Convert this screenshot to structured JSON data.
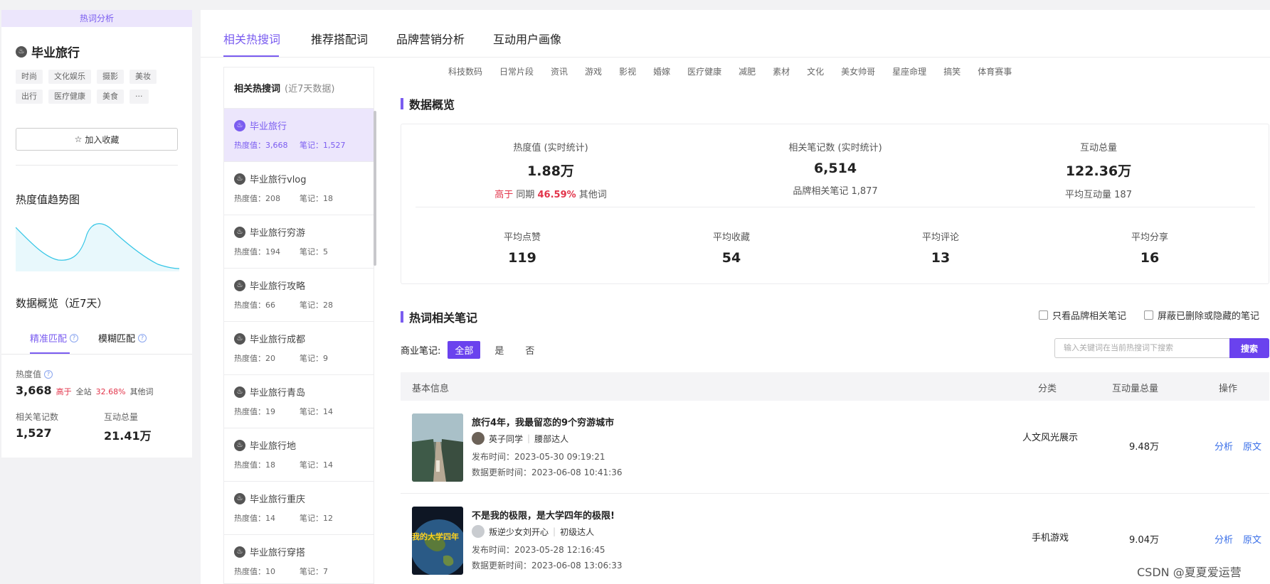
{
  "left": {
    "banner": "热词分析",
    "keyword": "毕业旅行",
    "tags_row1": [
      "时尚",
      "文化娱乐",
      "摄影",
      "美妆"
    ],
    "tags_row2": [
      "出行",
      "医疗健康",
      "美食",
      "···"
    ],
    "fav_label": "加入收藏",
    "trend_title": "热度值趋势图",
    "trend_color": "#35c6e6",
    "overview_title": "数据概览（近7天）",
    "match_tabs": [
      "精准匹配",
      "模糊匹配"
    ],
    "heat_label": "热度值",
    "heat_value": "3,668",
    "heat_cmp": "高于",
    "heat_scope": "全站",
    "heat_pct": "32.68%",
    "heat_other": "其他词",
    "notes_label": "相关笔记数",
    "notes_value": "1,527",
    "inter_label": "互动总量",
    "inter_value": "21.41万"
  },
  "tabs": [
    "相关热搜词",
    "推荐搭配词",
    "品牌营销分析",
    "互动用户画像"
  ],
  "related": {
    "header": "相关热搜词",
    "header_sub": "(近7天数据)",
    "heat_prefix": "热度值：",
    "notes_prefix": "笔记：",
    "items": [
      {
        "name": "毕业旅行",
        "heat": "3,668",
        "notes": "1,527"
      },
      {
        "name": "毕业旅行vlog",
        "heat": "208",
        "notes": "18"
      },
      {
        "name": "毕业旅行穷游",
        "heat": "194",
        "notes": "5"
      },
      {
        "name": "毕业旅行攻略",
        "heat": "66",
        "notes": "28"
      },
      {
        "name": "毕业旅行成都",
        "heat": "20",
        "notes": "9"
      },
      {
        "name": "毕业旅行青岛",
        "heat": "19",
        "notes": "14"
      },
      {
        "name": "毕业旅行地",
        "heat": "18",
        "notes": "14"
      },
      {
        "name": "毕业旅行重庆",
        "heat": "14",
        "notes": "12"
      },
      {
        "name": "毕业旅行穿搭",
        "heat": "10",
        "notes": "7"
      }
    ]
  },
  "categories": [
    "科技数码",
    "日常片段",
    "资讯",
    "游戏",
    "影视",
    "婚嫁",
    "医疗健康",
    "减肥",
    "素材",
    "文化",
    "美女帅哥",
    "星座命理",
    "搞笑",
    "体育赛事"
  ],
  "overview": {
    "title": "数据概览",
    "heat_label": "热度值 (实时统计)",
    "heat_value": "1.88万",
    "heat_cmp": "高于",
    "heat_period": "同期",
    "heat_pct": "46.59%",
    "heat_other": "其他词",
    "notes_label": "相关笔记数 (实时统计)",
    "notes_value": "6,514",
    "notes_sub": "品牌相关笔记 1,877",
    "inter_label": "互动总量",
    "inter_value": "122.36万",
    "inter_sub": "平均互动量 187",
    "likes_label": "平均点赞",
    "likes_value": "119",
    "fav_label": "平均收藏",
    "fav_value": "54",
    "comment_label": "平均评论",
    "comment_value": "13",
    "share_label": "平均分享",
    "share_value": "16"
  },
  "hot_notes": {
    "title": "热词相关笔记",
    "brand_only": "只看品牌相关笔记",
    "hide_deleted": "屏蔽已删除或隐藏的笔记",
    "filter_label": "商业笔记:",
    "filter_options": [
      "全部",
      "是",
      "否"
    ],
    "search_placeholder": "输入关键词在当前热搜词下搜索",
    "search_btn": "搜索",
    "columns": [
      "基本信息",
      "分类",
      "互动量总量",
      "操作"
    ],
    "pub_prefix": "发布时间：",
    "upd_prefix": "数据更新时间：",
    "op_analyze": "分析",
    "op_original": "原文",
    "rows": [
      {
        "title": "旅行4年，我最留恋的9个穷游城市",
        "author": "英子同学",
        "level": "腰部达人",
        "published": "2023-05-30 09:19:21",
        "updated": "2023-06-08 10:41:36",
        "category": "人文风光展示",
        "interactions": "9.48万"
      },
      {
        "title": "不是我的极限，是大学四年的极限!",
        "author": "叛逆少女刘开心",
        "level": "初级达人",
        "published": "2023-05-28 12:16:45",
        "updated": "2023-06-08 13:06:33",
        "category": "手机游戏",
        "interactions": "9.04万",
        "thumb_text": "我的大学四年"
      }
    ]
  },
  "watermark": "CSDN @夏夏爱运营",
  "colors": {
    "accent": "#7a5cf0",
    "accent_dark": "#6a42ee",
    "red": "#e2344a",
    "link": "#3a6fe8"
  }
}
